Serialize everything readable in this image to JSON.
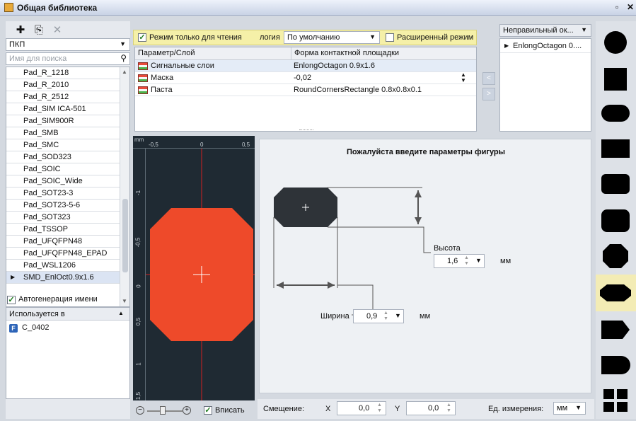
{
  "window": {
    "title": "Общая библиотека",
    "restore_glyph": "▫",
    "close_glyph": "✕"
  },
  "left": {
    "icons": [
      "plus-circle-icon",
      "copy-icon",
      "delete-icon"
    ],
    "plus_glyph": "✚",
    "copy_glyph": "⎘",
    "delete_glyph": "✕",
    "category": "ПКП",
    "search_placeholder": "Имя для поиска",
    "items": [
      "Pad_R_1218",
      "Pad_R_2010",
      "Pad_R_2512",
      "Pad_SIM ICA-501",
      "Pad_SIM900R",
      "Pad_SMB",
      "Pad_SMC",
      "Pad_SOD323",
      "Pad_SOIC",
      "Pad_SOIC_Wide",
      "Pad_SOT23-3",
      "Pad_SOT23-5-6",
      "Pad_SOT323",
      "Pad_TSSOP",
      "Pad_UFQFPN48",
      "Pad_UFQFPN48_EPAD",
      "Pad_WSL1206",
      "SMD_EnlOct0.9x1.6"
    ],
    "autogen_label": "Автогенерация имени",
    "used_in_label": "Используется в",
    "used_in_items": [
      "C_0402"
    ],
    "used_badge": "F"
  },
  "toolbar": {
    "readonly_label": "Режим только для чтения",
    "logic_label": "логия",
    "logic_value": "По умолчанию",
    "advanced_label": "Расширенный режим"
  },
  "grid": {
    "col1": "Параметр/Слой",
    "col2": "Форма контактной площадки",
    "rows": [
      {
        "layer": "Сигнальные слои",
        "value": "EnlongOctagon 0.9x1.6"
      },
      {
        "layer": "Маска",
        "value": "-0,02"
      },
      {
        "layer": "Паста",
        "value": "RoundCornersRectangle 0.8x0.8x0.1"
      }
    ]
  },
  "right_list": {
    "selector": "Неправильный ок...",
    "items": [
      "EnlongOctagon 0...."
    ]
  },
  "preview": {
    "unit": "mm",
    "h_ticks": [
      "-0,5",
      "0",
      "0,5"
    ],
    "v_ticks": [
      "-1",
      "-0,5",
      "0",
      "0,5",
      "1",
      "1,5"
    ],
    "pad_color": "#ee4a2a",
    "checkbox_label": "Вписать"
  },
  "dialog": {
    "title": "Пожалуйста введите параметры фигуры",
    "height_label": "Высота",
    "height_value": "1,6",
    "width_label": "Ширина",
    "width_value": "0,9",
    "unit": "мм"
  },
  "bottom": {
    "offset_label": "Смещение:",
    "x_label": "X",
    "x_value": "0,0",
    "y_label": "Y",
    "y_value": "0,0",
    "units_label": "Ед. измерения:",
    "units_value": "мм"
  }
}
